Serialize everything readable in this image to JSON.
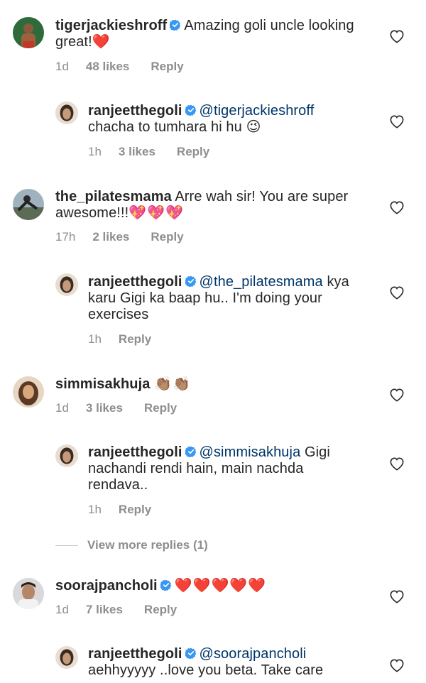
{
  "comments": [
    {
      "user": "tigerjackieshroff",
      "verified": true,
      "mention": "",
      "text": "Amazing goli uncle looking great!",
      "emoji": "❤️",
      "time": "1d",
      "likes": "48 likes",
      "reply": "Reply",
      "avatar_color": "#6b3a2a"
    },
    {
      "user": "ranjeetthegoli",
      "verified": true,
      "mention": "@tigerjackieshroff",
      "text": "chacha to tumhara hi hu",
      "emoji": "😉",
      "time": "1h",
      "likes": "3 likes",
      "reply": "Reply",
      "avatar_color": "#3a2a20"
    },
    {
      "user": "the_pilatesmama",
      "verified": false,
      "mention": "",
      "text": "Arre wah sir! You are super awesome!!!",
      "emoji": "💖💖💖",
      "time": "17h",
      "likes": "2 likes",
      "reply": "Reply",
      "avatar_color": "#6f7f8a"
    },
    {
      "user": "ranjeetthegoli",
      "verified": true,
      "mention": "@the_pilatesmama",
      "text": "kya karu Gigi ka baap hu.. I'm doing your exercises",
      "emoji": "",
      "time": "1h",
      "likes": "",
      "reply": "Reply",
      "avatar_color": "#3a2a20"
    },
    {
      "user": "simmisakhuja",
      "verified": false,
      "mention": "",
      "text": "",
      "emoji": "👏🏽👏🏽",
      "time": "1d",
      "likes": "3 likes",
      "reply": "Reply",
      "avatar_color": "#b38a6a"
    },
    {
      "user": "ranjeetthegoli",
      "verified": true,
      "mention": "@simmisakhuja",
      "text": "Gigi nachandi rendi hain, main nachda rendava..",
      "emoji": "",
      "time": "1h",
      "likes": "",
      "reply": "Reply",
      "avatar_color": "#3a2a20"
    },
    {
      "user": "soorajpancholi",
      "verified": true,
      "mention": "",
      "text": "",
      "emoji": "❤️❤️❤️❤️❤️",
      "time": "1d",
      "likes": "7 likes",
      "reply": "Reply",
      "avatar_color": "#5a5a5a"
    },
    {
      "user": "ranjeetthegoli",
      "verified": true,
      "mention": "@soorajpancholi",
      "text": "aehhyyyyy ..love you beta. Take care",
      "emoji": "",
      "time": "",
      "likes": "",
      "reply": "",
      "avatar_color": "#3a2a20"
    }
  ],
  "view_more_replies": "View more replies (1)",
  "colors": {
    "verified_blue": "#3897f0",
    "meta_grey": "#8e8e8e",
    "mention_blue": "#003569",
    "heart_red": "#ed1c24"
  }
}
